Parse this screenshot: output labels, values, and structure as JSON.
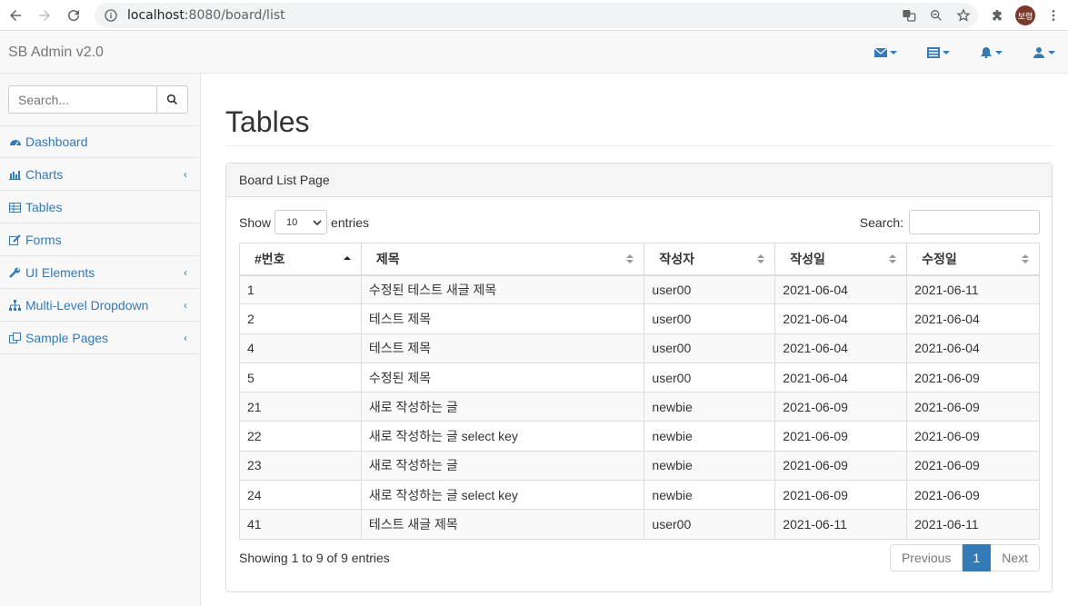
{
  "browser": {
    "url_host": "localhost",
    "url_rest": ":8080/board/list",
    "profile_label": "보령"
  },
  "navbar": {
    "brand": "SB Admin v2.0",
    "tools": [
      "envelope-icon",
      "tasks-icon",
      "bell-icon",
      "user-icon"
    ]
  },
  "sidebar": {
    "search_placeholder": "Search...",
    "items": [
      {
        "label": "Dashboard",
        "icon": "dashboard-icon",
        "has_children": false
      },
      {
        "label": "Charts",
        "icon": "bar-chart-icon",
        "has_children": true
      },
      {
        "label": "Tables",
        "icon": "table-icon",
        "has_children": false
      },
      {
        "label": "Forms",
        "icon": "edit-icon",
        "has_children": false
      },
      {
        "label": "UI Elements",
        "icon": "wrench-icon",
        "has_children": true
      },
      {
        "label": "Multi-Level Dropdown",
        "icon": "sitemap-icon",
        "has_children": true
      },
      {
        "label": "Sample Pages",
        "icon": "files-icon",
        "has_children": true
      }
    ]
  },
  "main": {
    "title": "Tables",
    "panel_heading": "Board List Page",
    "show_label": "Show",
    "page_length": "10",
    "entries_label": "entries",
    "search_label": "Search:",
    "columns": [
      "#번호",
      "제목",
      "작성자",
      "작성일",
      "수정일"
    ],
    "rows": [
      [
        "1",
        "수정된 테스트 새글 제목",
        "user00",
        "2021-06-04",
        "2021-06-11"
      ],
      [
        "2",
        "테스트 제목",
        "user00",
        "2021-06-04",
        "2021-06-04"
      ],
      [
        "4",
        "테스트 제목",
        "user00",
        "2021-06-04",
        "2021-06-04"
      ],
      [
        "5",
        "수정된 제목",
        "user00",
        "2021-06-04",
        "2021-06-09"
      ],
      [
        "21",
        "새로 작성하는 글",
        "newbie",
        "2021-06-09",
        "2021-06-09"
      ],
      [
        "22",
        "새로 작성하는 글 select key",
        "newbie",
        "2021-06-09",
        "2021-06-09"
      ],
      [
        "23",
        "새로 작성하는 글",
        "newbie",
        "2021-06-09",
        "2021-06-09"
      ],
      [
        "24",
        "새로 작성하는 글 select key",
        "newbie",
        "2021-06-09",
        "2021-06-09"
      ],
      [
        "41",
        "테스트 새글 제목",
        "user00",
        "2021-06-11",
        "2021-06-11"
      ]
    ],
    "info": "Showing 1 to 9 of 9 entries",
    "pager": {
      "prev": "Previous",
      "current": "1",
      "next": "Next"
    }
  },
  "colors": {
    "link": "#337ab7",
    "active_page": "#337ab7"
  }
}
